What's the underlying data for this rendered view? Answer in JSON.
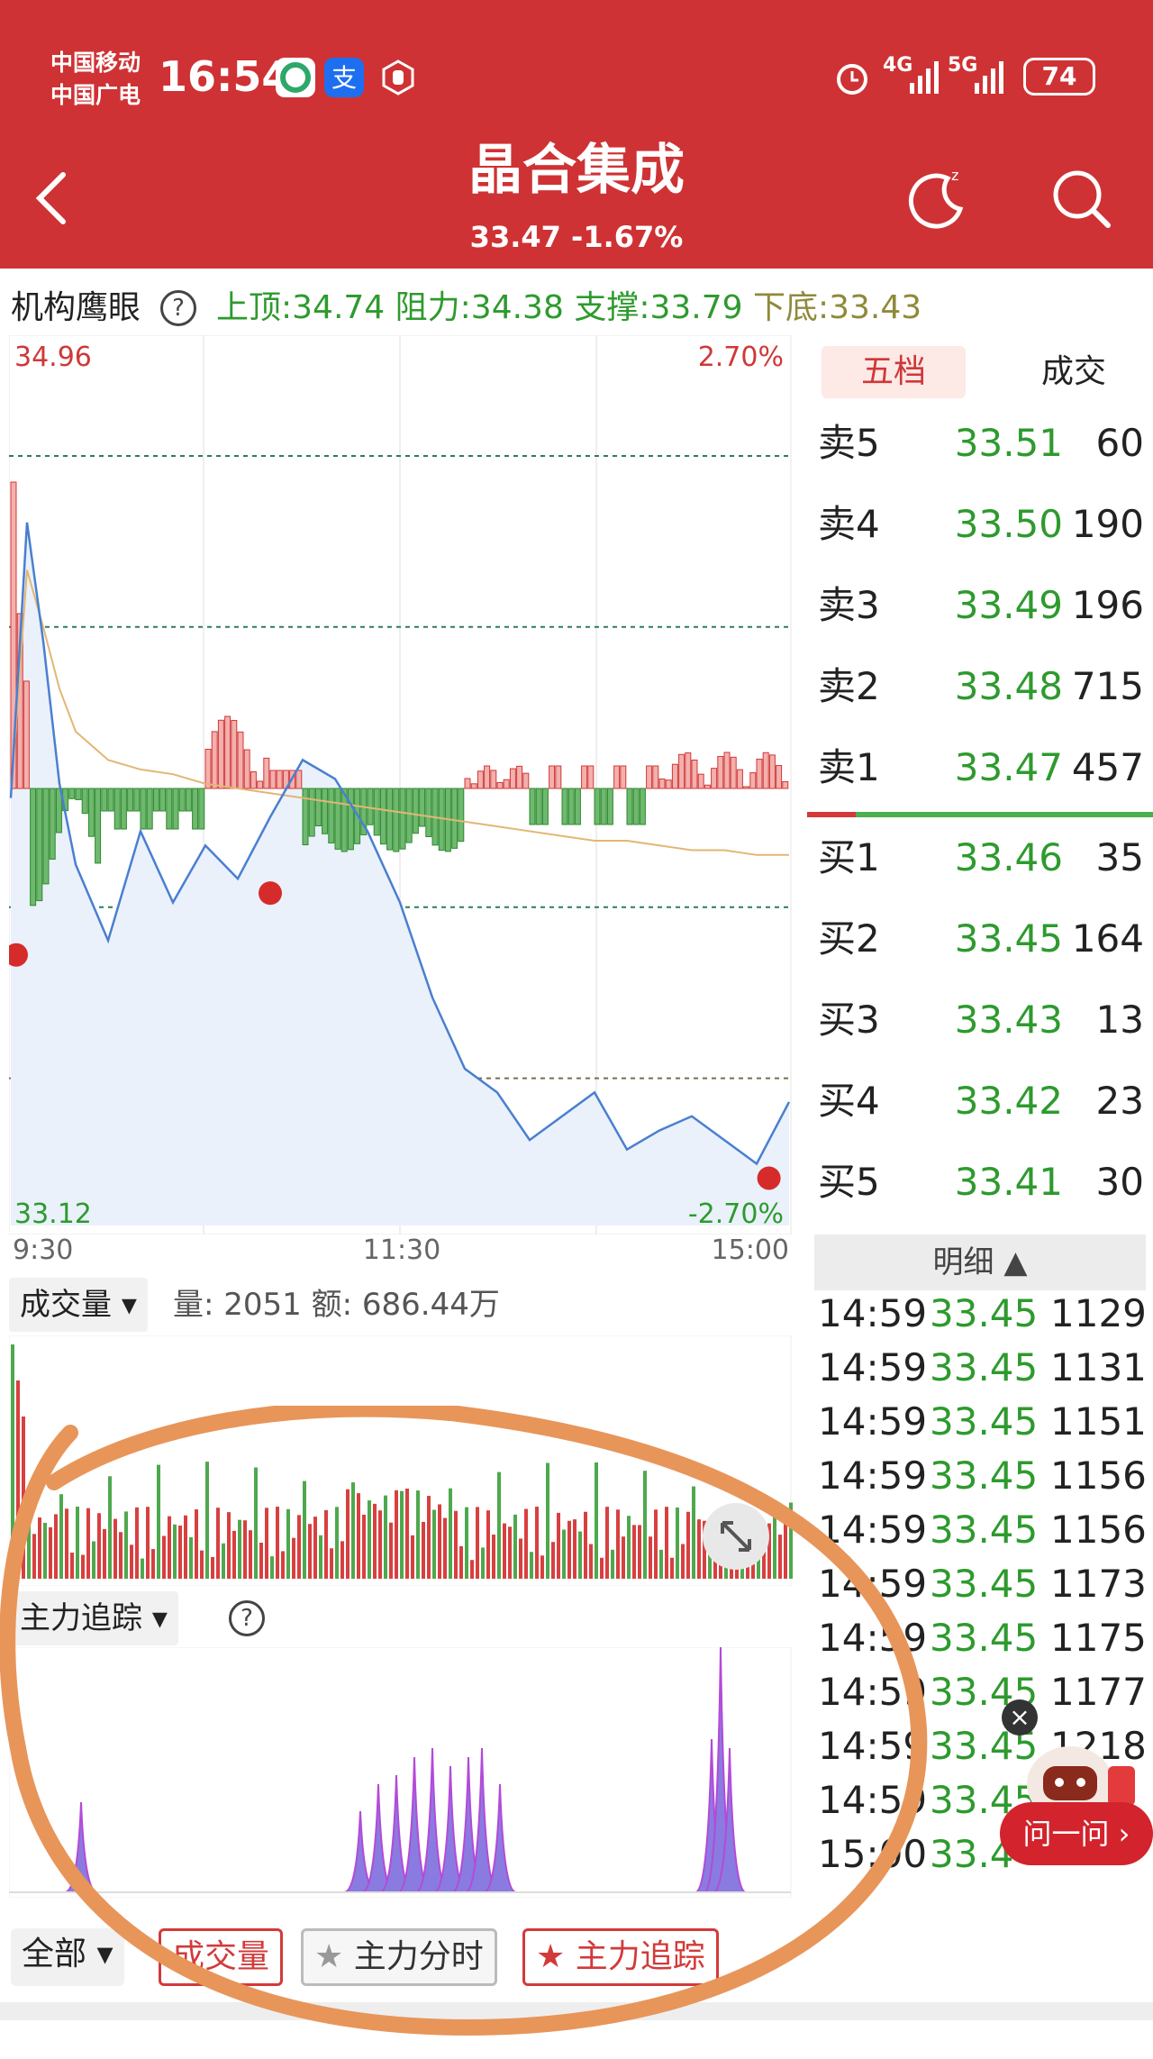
{
  "status_bar": {
    "carrier1": "中国移动",
    "carrier2": "中国广电",
    "time": "16:54",
    "signal1": "4G",
    "signal2": "5G",
    "battery": "74"
  },
  "header": {
    "title": "晶合集成",
    "subtitle": "33.47 -1.67%"
  },
  "eye": {
    "label": "机构鹰眼",
    "help": "?",
    "top": "上顶:34.74",
    "resist": "阻力:34.38",
    "support": "支撑:33.79",
    "bottom": "下底:33.43"
  },
  "chart_data": {
    "type": "line",
    "title": "",
    "price_high": "34.96",
    "price_low": "33.12",
    "pct_high": "2.70%",
    "pct_low": "-2.70%",
    "x_ticks": [
      "9:30",
      "11:30",
      "15:00"
    ],
    "ylim": [
      33.12,
      34.96
    ],
    "reference_lines": [
      34.74,
      34.38,
      33.79,
      33.43
    ],
    "prev_close": 34.04,
    "x": [
      0,
      5,
      10,
      15,
      20,
      30,
      40,
      50,
      60,
      70,
      80,
      90,
      100,
      110,
      120,
      130,
      140,
      150,
      160,
      170,
      180,
      190,
      200,
      210,
      220,
      230,
      240
    ],
    "price": [
      34.02,
      34.6,
      34.35,
      34.05,
      33.88,
      33.72,
      33.95,
      33.8,
      33.92,
      33.85,
      33.98,
      34.1,
      34.06,
      33.95,
      33.8,
      33.6,
      33.45,
      33.4,
      33.3,
      33.35,
      33.4,
      33.28,
      33.32,
      33.35,
      33.3,
      33.25,
      33.38
    ],
    "avg_price": [
      34.02,
      34.5,
      34.38,
      34.25,
      34.16,
      34.1,
      34.08,
      34.07,
      34.05,
      34.04,
      34.03,
      34.02,
      34.01,
      34.0,
      33.99,
      33.98,
      33.97,
      33.96,
      33.95,
      33.94,
      33.93,
      33.93,
      33.92,
      33.91,
      33.91,
      33.9,
      33.9
    ]
  },
  "orderbook": {
    "tab_active": "五档",
    "tab_other": "成交",
    "rows": [
      {
        "label": "卖5",
        "price": "33.51",
        "vol": "60"
      },
      {
        "label": "卖4",
        "price": "33.50",
        "vol": "190"
      },
      {
        "label": "卖3",
        "price": "33.49",
        "vol": "196"
      },
      {
        "label": "卖2",
        "price": "33.48",
        "vol": "715"
      },
      {
        "label": "卖1",
        "price": "33.47",
        "vol": "457"
      },
      {
        "label": "买1",
        "price": "33.46",
        "vol": "35"
      },
      {
        "label": "买2",
        "price": "33.45",
        "vol": "164"
      },
      {
        "label": "买3",
        "price": "33.43",
        "vol": "13"
      },
      {
        "label": "买4",
        "price": "33.42",
        "vol": "23"
      },
      {
        "label": "买5",
        "price": "33.41",
        "vol": "30"
      }
    ],
    "detail_label": "明细 ▲",
    "trades": [
      {
        "t": "14:59",
        "p": "33.45",
        "v": "1129"
      },
      {
        "t": "14:59",
        "p": "33.45",
        "v": "1131"
      },
      {
        "t": "14:59",
        "p": "33.45",
        "v": "1151"
      },
      {
        "t": "14:59",
        "p": "33.45",
        "v": "1156"
      },
      {
        "t": "14:59",
        "p": "33.45",
        "v": "1156"
      },
      {
        "t": "14:59",
        "p": "33.45",
        "v": "1173"
      },
      {
        "t": "14:59",
        "p": "33.45",
        "v": "1175"
      },
      {
        "t": "14:59",
        "p": "33.45",
        "v": "1177"
      },
      {
        "t": "14:59",
        "p": "33.45",
        "v": "1218"
      },
      {
        "t": "14:59",
        "p": "33.45",
        "v": ""
      },
      {
        "t": "15:00",
        "p": "33.4",
        "v": ""
      }
    ]
  },
  "volume": {
    "dropdown": "成交量",
    "info": "量: 2051 额: 686.44万"
  },
  "main_force": {
    "dropdown": "主力追踪",
    "help": "?"
  },
  "bottom_bar": {
    "all": "全部",
    "b1": "成交量",
    "b2": "主力分时",
    "b3": "主力追踪"
  },
  "ask": "问一问 ›",
  "colors": {
    "brand_red": "#cf3234",
    "up": "#d03838",
    "down": "#2e9a2e",
    "line": "#4a7fd0",
    "purple": "#b44ad8"
  }
}
